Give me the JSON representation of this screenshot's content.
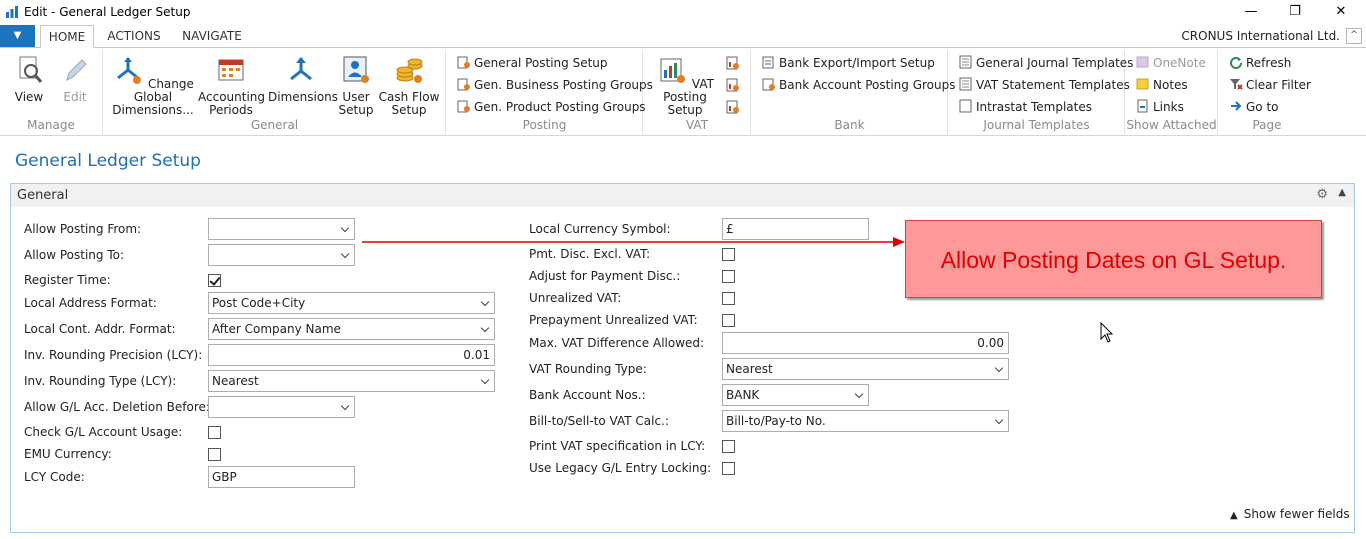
{
  "window": {
    "title": "Edit - General Ledger Setup",
    "controls": [
      "—",
      "❐",
      "✕"
    ]
  },
  "ribbon_tabs": {
    "items": [
      "HOME",
      "ACTIONS",
      "NAVIGATE"
    ],
    "active": "HOME",
    "company": "CRONUS International Ltd.",
    "app_menu_glyph": "▼",
    "collapse_glyph": "^"
  },
  "ribbon": {
    "manage": {
      "label": "Manage",
      "view": "View",
      "edit": "Edit"
    },
    "general": {
      "label": "General",
      "change_global_dimensions": "Change Global Dimensions...",
      "accounting_periods": "Accounting Periods",
      "dimensions": "Dimensions",
      "user_setup": "User Setup",
      "cash_flow_setup": "Cash Flow Setup"
    },
    "posting": {
      "label": "Posting",
      "general_posting_setup": "General Posting Setup",
      "gen_business_posting_groups": "Gen. Business Posting Groups",
      "gen_product_posting_groups": "Gen. Product Posting Groups"
    },
    "vat": {
      "label": "VAT",
      "vat_posting_setup": "VAT Posting Setup"
    },
    "bank": {
      "label": "Bank",
      "bank_export_import_setup": "Bank Export/Import Setup",
      "bank_account_posting_groups": "Bank Account Posting Groups"
    },
    "journal_templates": {
      "label": "Journal Templates",
      "general_journal_templates": "General Journal Templates",
      "vat_statement_templates": "VAT Statement Templates",
      "intrastat_templates": "Intrastat Templates"
    },
    "show_attached": {
      "label": "Show Attached",
      "onenote": "OneNote",
      "notes": "Notes",
      "links": "Links"
    },
    "page": {
      "label": "Page",
      "refresh": "Refresh",
      "clear_filter": "Clear Filter",
      "go_to": "Go to"
    }
  },
  "page": {
    "title": "General Ledger Setup",
    "fasttab": "General",
    "show_fewer": "Show fewer fields"
  },
  "left_fields": {
    "allow_posting_from": {
      "label": "Allow Posting From:",
      "value": ""
    },
    "allow_posting_to": {
      "label": "Allow Posting To:",
      "value": ""
    },
    "register_time": {
      "label": "Register Time:",
      "checked": true
    },
    "local_address_format": {
      "label": "Local Address Format:",
      "value": "Post Code+City"
    },
    "local_cont_addr_format": {
      "label": "Local Cont. Addr. Format:",
      "value": "After Company Name"
    },
    "inv_rounding_precision": {
      "label": "Inv. Rounding Precision (LCY):",
      "value": "0.01"
    },
    "inv_rounding_type": {
      "label": "Inv. Rounding Type (LCY):",
      "value": "Nearest"
    },
    "allow_gl_deletion": {
      "label": "Allow G/L Acc. Deletion Before:",
      "value": ""
    },
    "check_gl_usage": {
      "label": "Check G/L Account Usage:",
      "checked": false
    },
    "emu_currency": {
      "label": "EMU Currency:",
      "checked": false
    },
    "lcy_code": {
      "label": "LCY Code:",
      "value": "GBP"
    }
  },
  "right_fields": {
    "local_currency_symbol": {
      "label": "Local Currency Symbol:",
      "value": "£"
    },
    "pmt_disc_excl_vat": {
      "label": "Pmt. Disc. Excl. VAT:",
      "checked": false
    },
    "adjust_for_payment_disc": {
      "label": "Adjust for Payment Disc.:",
      "checked": false
    },
    "unrealized_vat": {
      "label": "Unrealized VAT:",
      "checked": false
    },
    "prepayment_unrealized_vat": {
      "label": "Prepayment Unrealized VAT:",
      "checked": false
    },
    "max_vat_difference": {
      "label": "Max. VAT Difference Allowed:",
      "value": "0.00"
    },
    "vat_rounding_type": {
      "label": "VAT Rounding Type:",
      "value": "Nearest"
    },
    "bank_account_nos": {
      "label": "Bank Account Nos.:",
      "value": "BANK"
    },
    "bill_to_sell_to_vat_calc": {
      "label": "Bill-to/Sell-to VAT Calc.:",
      "value": "Bill-to/Pay-to No."
    },
    "print_vat_spec_lcy": {
      "label": "Print VAT specification in LCY:",
      "checked": false
    },
    "use_legacy_gl_locking": {
      "label": "Use Legacy G/L Entry Locking:",
      "checked": false
    }
  },
  "annotation": {
    "text": "Allow Posting Dates on GL Setup.",
    "color": "#e00000",
    "fill": "#ff9999"
  }
}
